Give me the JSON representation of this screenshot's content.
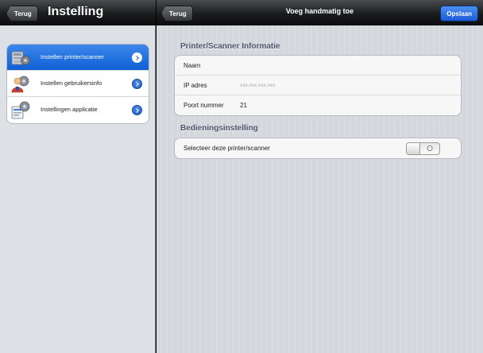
{
  "left": {
    "back_label": "Terug",
    "title": "Instelling",
    "menu": [
      {
        "label": "Instellen printer/scanner",
        "icon": "printer-scanner-icon",
        "selected": true
      },
      {
        "label": "Instellen gebruikersinfo",
        "icon": "user-info-icon",
        "selected": false
      },
      {
        "label": "Instellingen applicatie",
        "icon": "application-settings-icon",
        "selected": false
      }
    ]
  },
  "right": {
    "back_label": "Terug",
    "title": "Voeg handmatig toe",
    "save_label": "Opslaan",
    "info_section": {
      "header": "Printer/Scanner Informatie",
      "rows": [
        {
          "label": "Naam",
          "value": ""
        },
        {
          "label": "IP adres",
          "placeholder": "xxx.xxx.xxx.xxx"
        },
        {
          "label": "Poort nummer",
          "value": "21"
        }
      ]
    },
    "operation_section": {
      "header": "Bedieningsinstelling",
      "rows": [
        {
          "label": "Selecteer deze printer/scanner",
          "toggle": "off",
          "toggle_symbol": "O"
        }
      ]
    }
  },
  "colors": {
    "selection_blue": "#1f6fe0",
    "save_button_blue": "#2a6fe6",
    "navbar_black": "#1c1d1f"
  }
}
